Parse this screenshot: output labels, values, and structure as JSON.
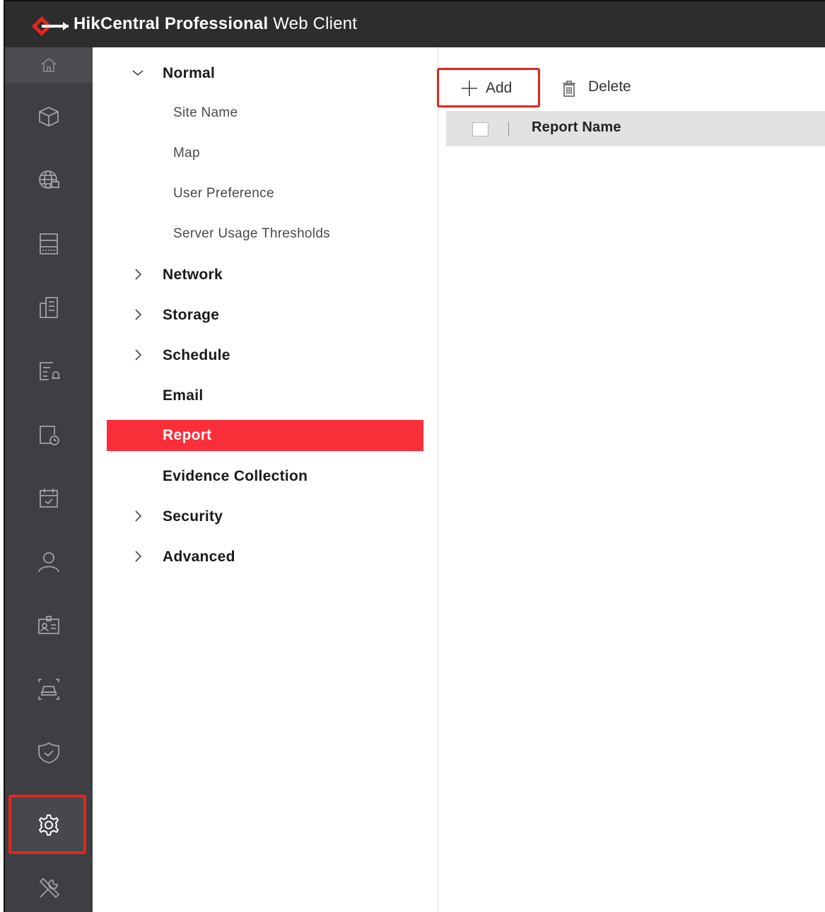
{
  "app": {
    "title_brand": "HikCentral Professional",
    "title_rest": " Web Client"
  },
  "colors": {
    "accent": "#fb2f3a",
    "topbar": "#2d2d2d",
    "rail": "#3d3f42",
    "highlight_outline": "#e3261f"
  },
  "rail": {
    "items": [
      {
        "icon": "home-icon"
      },
      {
        "icon": "cube-icon"
      },
      {
        "icon": "globe-icon"
      },
      {
        "icon": "server-icon"
      },
      {
        "icon": "building-icon"
      },
      {
        "icon": "event-icon"
      },
      {
        "icon": "device-clock-icon"
      },
      {
        "icon": "calendar-check-icon"
      },
      {
        "icon": "person-icon"
      },
      {
        "icon": "id-card-icon"
      },
      {
        "icon": "vehicle-icon"
      },
      {
        "icon": "shield-check-icon"
      },
      {
        "icon": "gear-icon"
      },
      {
        "icon": "tools-icon"
      }
    ]
  },
  "nav": {
    "normal": "Normal",
    "site_name": "Site Name",
    "map": "Map",
    "user_preference": "User Preference",
    "server_usage_thresholds": "Server Usage Thresholds",
    "network": "Network",
    "storage": "Storage",
    "schedule": "Schedule",
    "email": "Email",
    "report": "Report",
    "evidence_collection": "Evidence Collection",
    "security": "Security",
    "advanced": "Advanced"
  },
  "toolbar": {
    "add_label": "Add",
    "delete_label": "Delete"
  },
  "table": {
    "columns": [
      "Report Name"
    ]
  }
}
